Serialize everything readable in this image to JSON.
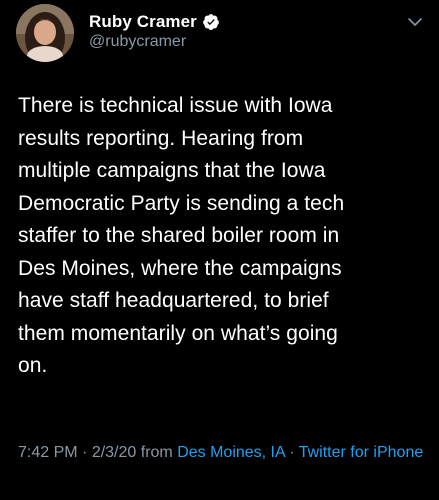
{
  "author": {
    "name": "Ruby Cramer",
    "handle": "@rubycramer",
    "verified": true
  },
  "icons": {
    "avatar": "profile-photo",
    "verified": "verified-badge-icon",
    "menu": "chevron-down-icon"
  },
  "tweet": {
    "text": "There is technical issue with Iowa\nresults reporting. Hearing from\nmultiple campaigns that the Iowa\nDemocratic Party is sending a tech\nstaffer to the shared boiler room in\nDes Moines, where the campaigns\nhave staff headquartered, to brief\nthem momentarily on what’s going\non."
  },
  "meta": {
    "time": "7:42 PM",
    "separator": " · ",
    "date": "2/3/20",
    "from_label": " from ",
    "location": "Des Moines, IA",
    "separator2": " · ",
    "source": "Twitter for iPhone"
  },
  "colors": {
    "background": "#000000",
    "text": "#ffffff",
    "secondary": "#8899a6",
    "link": "#1da1f2"
  }
}
